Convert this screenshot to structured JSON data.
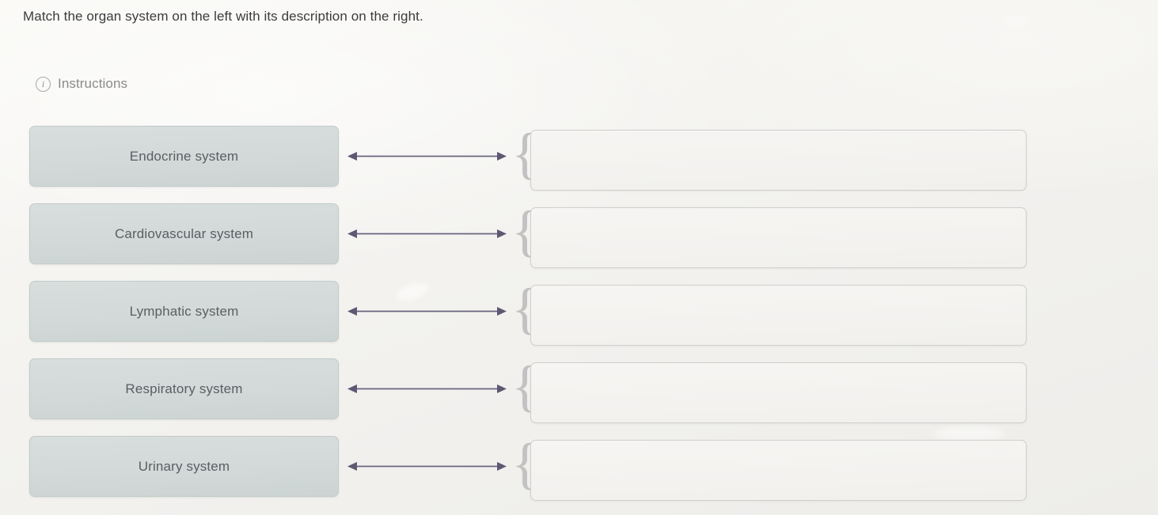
{
  "prompt": "Match the organ system on the left with its description on the right.",
  "instructions": {
    "icon": "info-circle-icon",
    "label": "Instructions"
  },
  "colors": {
    "page_background": "#f5f4f1",
    "term_box_fill": "#d4dbda",
    "term_box_border": "#c3cbcb",
    "term_text": "#5d5d63",
    "drop_box_fill": "#f2f1ef",
    "drop_box_border": "#cfcfcd",
    "arrow": "#6b6480",
    "brace": "#c2c2c2",
    "prompt_text": "#3c3c3c",
    "instructions_text": "#8b8b8b"
  },
  "rows": [
    {
      "term": "Endocrine system",
      "connector": "double-headed-arrow",
      "brace": "{",
      "description": ""
    },
    {
      "term": "Cardiovascular system",
      "connector": "double-headed-arrow",
      "brace": "{",
      "description": ""
    },
    {
      "term": "Lymphatic system",
      "connector": "double-headed-arrow",
      "brace": "{",
      "description": ""
    },
    {
      "term": "Respiratory system",
      "connector": "double-headed-arrow",
      "brace": "{",
      "description": ""
    },
    {
      "term": "Urinary system",
      "connector": "double-headed-arrow",
      "brace": "{",
      "description": ""
    }
  ]
}
